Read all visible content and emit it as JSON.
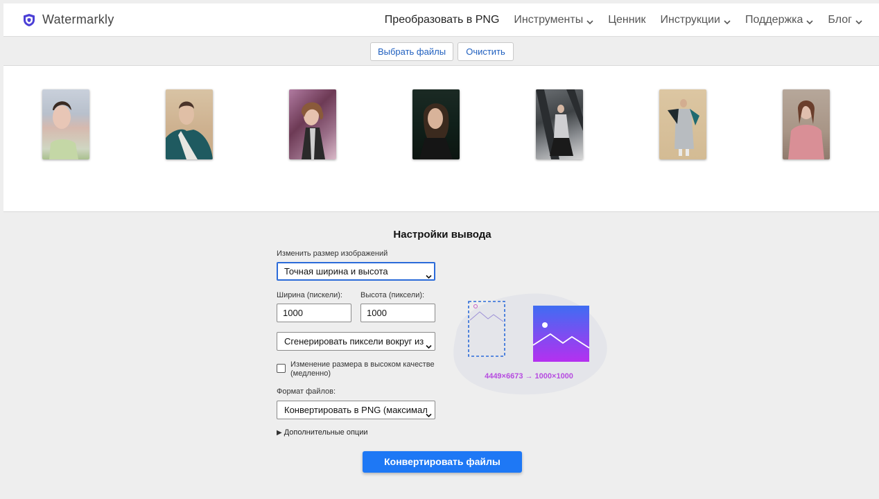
{
  "header": {
    "brand": "Watermarkly",
    "nav": [
      {
        "label": "Преобразовать в PNG",
        "dropdown": false
      },
      {
        "label": "Инструменты",
        "dropdown": true
      },
      {
        "label": "Ценник",
        "dropdown": false
      },
      {
        "label": "Инструкции",
        "dropdown": true
      },
      {
        "label": "Поддержка",
        "dropdown": true
      },
      {
        "label": "Блог",
        "dropdown": true
      }
    ]
  },
  "filebar": {
    "select_files": "Выбрать файлы",
    "clear": "Очистить"
  },
  "gallery": {
    "count": 7
  },
  "settings": {
    "title": "Настройки вывода",
    "resize_label": "Изменить размер изображений",
    "resize_value": "Точная ширина и высота",
    "width_label": "Ширина (пискели):",
    "width_value": "1000",
    "height_label": "Высота (пиксели):",
    "height_value": "1000",
    "fill_value": "Сгенерировать пиксели вокруг из",
    "hq_label": "Изменение размера в высоком качестве (медленно)",
    "hq_checked": false,
    "format_label": "Формат файлов:",
    "format_value": "Конвертировать в PNG (максимал",
    "more_options": "Дополнительные опции",
    "more_arrow": "▶",
    "convert_button": "Конвертировать файлы"
  },
  "preview": {
    "dimensions": "4449×6673 → 1000×1000"
  },
  "colors": {
    "accent": "#1e78f5",
    "link": "#1f5fbf",
    "preview_text": "#b64be0",
    "gradient_top": "#3f6df2",
    "gradient_bottom": "#b530f0",
    "dashed_box": "#2a6ad9"
  }
}
